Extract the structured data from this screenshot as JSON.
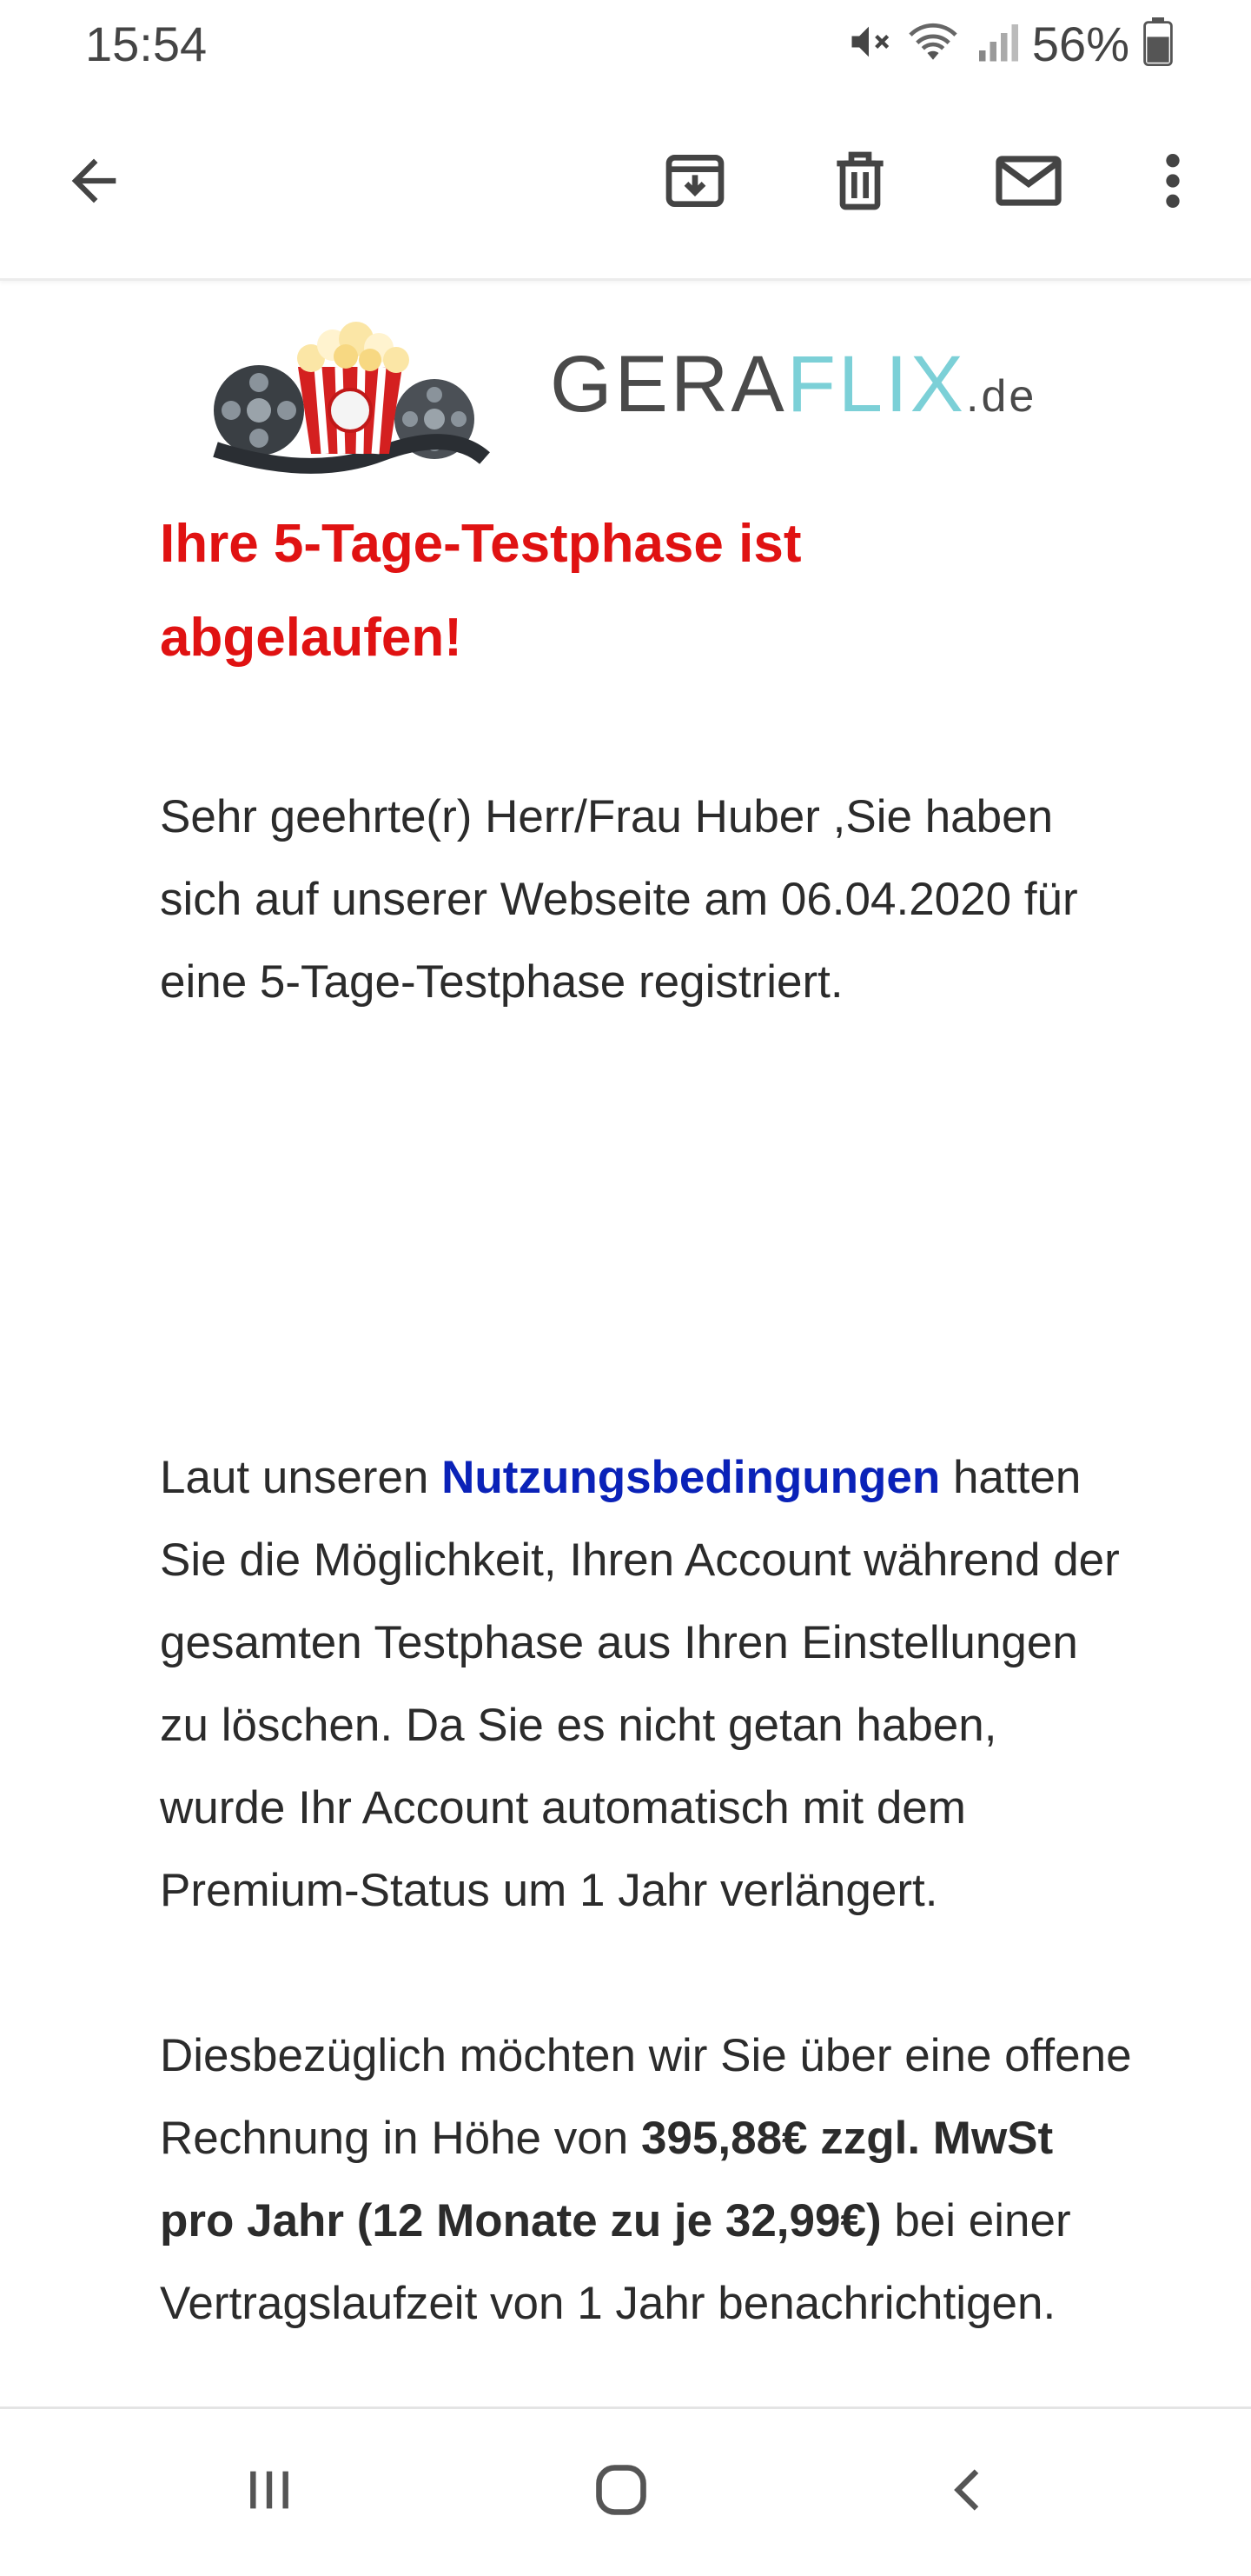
{
  "status_bar": {
    "time": "15:54",
    "battery_percent": "56%",
    "icons": [
      "mute-icon",
      "wifi-icon",
      "signal-icon",
      "battery-icon"
    ]
  },
  "toolbar": {
    "icons": [
      "back-arrow-icon",
      "archive-icon",
      "delete-icon",
      "mark-unread-icon",
      "more-options-icon"
    ]
  },
  "email": {
    "logo": {
      "part1": "GERA",
      "part2": "FLIX",
      "part3": ".de"
    },
    "headline": "Ihre 5-Tage-Testphase ist abgelaufen!",
    "paragraph1": "Sehr geehrte(r) Herr/Frau Huber ,Sie haben sich auf unserer Webseite am 06.04.2020 für eine 5-Tage-Testphase registriert.",
    "paragraph2_before_link": "Laut unseren ",
    "paragraph2_link": "Nutzungsbedingungen",
    "paragraph2_after_link": " hatten Sie die Möglichkeit, Ihren Account während der gesamten Testphase aus Ihren Einstellungen zu löschen. Da Sie es nicht getan haben, wurde Ihr Account automatisch mit dem Premium-Status um 1 Jahr verlängert.",
    "paragraph3_before_bold": "Diesbezüglich möchten wir Sie über eine offene Rechnung in Höhe von ",
    "paragraph3_bold": "395,88€ zzgl. MwSt pro Jahr (12 Monate zu je 32,99€)",
    "paragraph3_after_bold": " bei einer Vertragslaufzeit von 1 Jahr benachrichtigen."
  },
  "colors": {
    "headline": "#e01212",
    "link": "#0a22b8",
    "logo_flix": "#7cd0d7"
  },
  "navigation_bar": {
    "icons": [
      "recent-apps-icon",
      "home-icon",
      "back-icon"
    ]
  }
}
